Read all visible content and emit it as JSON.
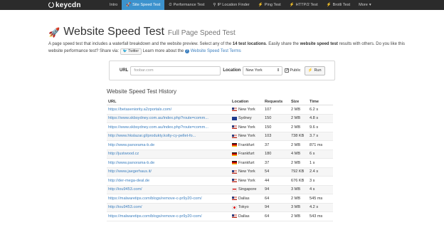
{
  "nav": {
    "brand": "keycdn",
    "items": [
      {
        "label": "Intro",
        "icon": "",
        "active": false
      },
      {
        "label": "Site Speed Test",
        "icon": "🚀",
        "active": true
      },
      {
        "label": "Performance Test",
        "icon": "⏲",
        "active": false
      },
      {
        "label": "IP Location Finder",
        "icon": "⚲",
        "active": false
      },
      {
        "label": "Ping Test",
        "icon": "⚡",
        "active": false
      },
      {
        "label": "HTTP/2 Test",
        "icon": "⚡",
        "active": false
      },
      {
        "label": "Brotli Test",
        "icon": "⚡",
        "active": false
      },
      {
        "label": "More",
        "icon": "",
        "active": false
      }
    ],
    "more_caret": "▾"
  },
  "page": {
    "title": "Website Speed Test",
    "subtitle": "Full Page Speed Test",
    "intro_1": "A page speed test that includes a waterfall breakdown and the website preview. Select any of the ",
    "intro_bold_1": "14 test locations",
    "intro_2": ". Easily share the ",
    "intro_bold_2": "website speed test",
    "intro_3": " results with others. Do you like this website performance test? Share via: ",
    "twitter_label": "Twitter",
    "intro_4": " Learn more about the ",
    "terms_link": "Website Speed Test Terms"
  },
  "form": {
    "url_label": "URL",
    "url_placeholder": "foobar.com",
    "location_label": "Location",
    "location_value": "New York",
    "public_label": "Public",
    "run_label": "Run"
  },
  "history": {
    "title": "Website Speed Test History",
    "columns": {
      "url": "URL",
      "location": "Location",
      "requests": "Requests",
      "size": "Size",
      "time": "Time"
    },
    "rows": [
      {
        "url": "https://betaseniority.a2zportals.com/",
        "flag": "US",
        "location": "New York",
        "requests": "107",
        "size": "2 MB",
        "time": "6.2 s"
      },
      {
        "url": "https://www.skbsydney.com.au/index.php?route=comm...",
        "flag": "AU",
        "location": "Sydney",
        "requests": "150",
        "size": "2 MB",
        "time": "4.8 s"
      },
      {
        "url": "https://www.skbsydney.com.au/index.php?route=comm...",
        "flag": "US",
        "location": "New York",
        "requests": "150",
        "size": "2 MB",
        "time": "9.6 s"
      },
      {
        "url": "http://www.hkslazar.gl/produkty.kolty-cy-pellet-fo...",
        "flag": "US",
        "location": "New York",
        "requests": "103",
        "size": "738 KB",
        "time": "3.7 s"
      },
      {
        "url": "http://www.panorama-b.de",
        "flag": "DE",
        "location": "Frankfurt",
        "requests": "37",
        "size": "2 MB",
        "time": "871 ms"
      },
      {
        "url": "http://justwood.cz",
        "flag": "DE",
        "location": "Frankfurt",
        "requests": "180",
        "size": "4 MB",
        "time": "6 s"
      },
      {
        "url": "http://www.panorama-b.de",
        "flag": "DE",
        "location": "Frankfurt",
        "requests": "37",
        "size": "2 MB",
        "time": "1 s"
      },
      {
        "url": "http://www.jaegerhaus.it/",
        "flag": "US",
        "location": "New York",
        "requests": "54",
        "size": "792 KB",
        "time": "2.4 s"
      },
      {
        "url": "http://der-mega-deal.de",
        "flag": "US",
        "location": "New York",
        "requests": "44",
        "size": "676 KB",
        "time": "3 s"
      },
      {
        "url": "http://iou9453.com/",
        "flag": "SG",
        "location": "Singapore",
        "requests": "94",
        "size": "3 MB",
        "time": "4 s"
      },
      {
        "url": "https://malwaretips.com/blogs/remove-c-pr9y20-com/",
        "flag": "US",
        "location": "Dallas",
        "requests": "64",
        "size": "2 MB",
        "time": "545 ms"
      },
      {
        "url": "http://iou9453.com/",
        "flag": "JP",
        "location": "Tokyo",
        "requests": "94",
        "size": "3 MB",
        "time": "4.2 s"
      },
      {
        "url": "https://malwaretips.com/blogs/remove-c-pr9y20-com/",
        "flag": "US",
        "location": "Dallas",
        "requests": "64",
        "size": "2 MB",
        "time": "543 ms"
      }
    ]
  }
}
